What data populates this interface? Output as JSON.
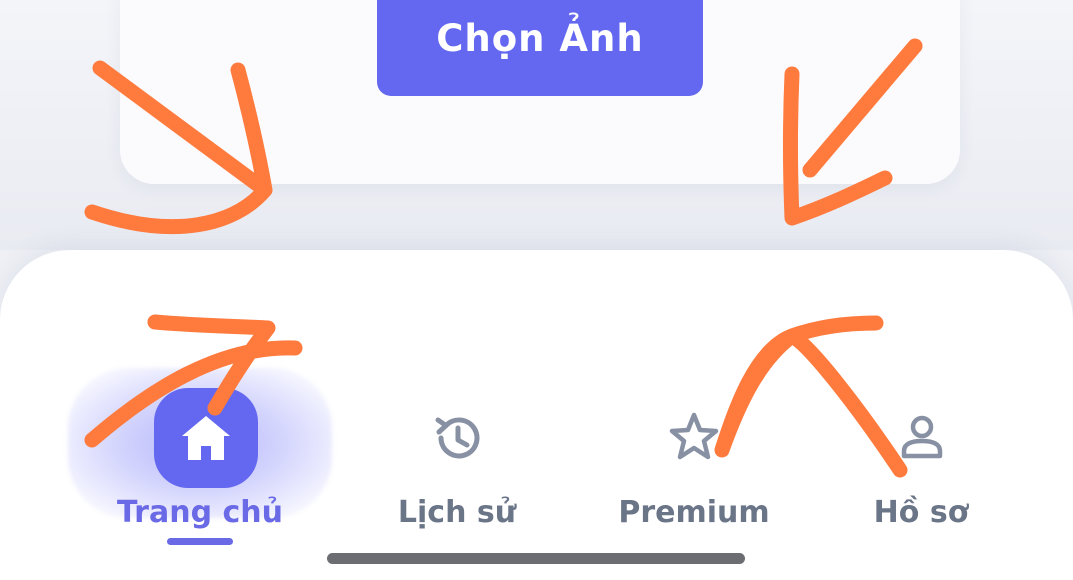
{
  "upload_card": {
    "choose_photo_label": "Chọn Ảnh"
  },
  "bottom_nav": {
    "items": [
      {
        "label": "Trang chủ",
        "icon": "home-icon",
        "active": true
      },
      {
        "label": "Lịch sử",
        "icon": "history-icon",
        "active": false
      },
      {
        "label": "Premium",
        "icon": "star-icon",
        "active": false
      },
      {
        "label": "Hồ sơ",
        "icon": "profile-icon",
        "active": false
      }
    ]
  },
  "colors": {
    "accent": "#6468f0",
    "active_label": "#6a69e6",
    "inactive_label": "#6b7588",
    "annotation": "#ff7a3d"
  }
}
